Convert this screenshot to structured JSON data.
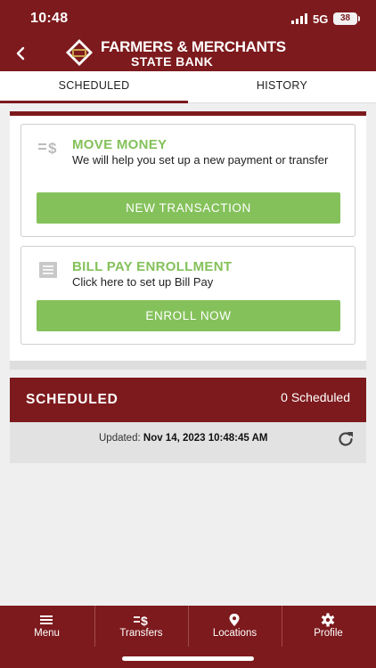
{
  "status_bar": {
    "time": "10:48",
    "network": "5G",
    "battery": "38"
  },
  "header": {
    "brand_line1": "FARMERS & MERCHANTS",
    "brand_line2": "STATE BANK"
  },
  "tabs": [
    {
      "label": "SCHEDULED",
      "active": true
    },
    {
      "label": "HISTORY",
      "active": false
    }
  ],
  "move_money": {
    "title": "MOVE MONEY",
    "description": "We will help you set up a new payment or transfer",
    "button": "NEW TRANSACTION",
    "icon": "transfer-dollar-icon"
  },
  "bill_pay": {
    "title": "BILL PAY ENROLLMENT",
    "description": "Click here to set up Bill Pay",
    "button": "ENROLL NOW",
    "icon": "document-icon"
  },
  "scheduled": {
    "heading": "SCHEDULED",
    "count": "0 Scheduled",
    "updated_label": "Updated:",
    "updated_value": "Nov 14, 2023 10:48:45 AM"
  },
  "tab_bar": [
    {
      "label": "Menu",
      "icon": "hamburger-icon"
    },
    {
      "label": "Transfers",
      "icon": "transfer-dollar-icon"
    },
    {
      "label": "Locations",
      "icon": "location-pin-icon"
    },
    {
      "label": "Profile",
      "icon": "gear-icon"
    }
  ],
  "colors": {
    "brand": "#7d1a1d",
    "accent": "#84c15a",
    "background": "#efefef"
  }
}
